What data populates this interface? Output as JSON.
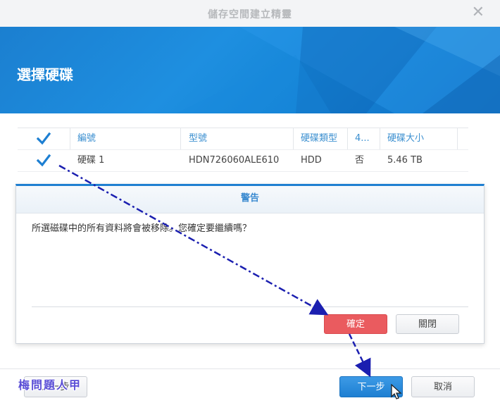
{
  "window": {
    "title": "儲存空間建立精靈",
    "close_glyph": "✕"
  },
  "banner": {
    "heading": "選擇硬碟"
  },
  "table": {
    "headers": [
      "編號",
      "型號",
      "硬碟類型",
      "4...",
      "硬碟大小"
    ],
    "rows": [
      {
        "checked": true,
        "number": "硬碟 1",
        "model": "HDN726060ALE610",
        "type": "HDD",
        "col4": "否",
        "size": "5.46 TB"
      }
    ],
    "header_checked": true
  },
  "warning": {
    "title": "警告",
    "message": "所選磁碟中的所有資料將會被移除。您確定要繼續嗎？",
    "ok_label": "確定",
    "close_label": "關閉"
  },
  "footer": {
    "prev_label": "上一步",
    "next_label": "下一步",
    "cancel_label": "取消"
  },
  "watermark": "梅問題人甲",
  "colors": {
    "accent": "#1f7fd1",
    "danger": "#ea5b5f",
    "annotation_arrow": "#1b1fb0"
  }
}
